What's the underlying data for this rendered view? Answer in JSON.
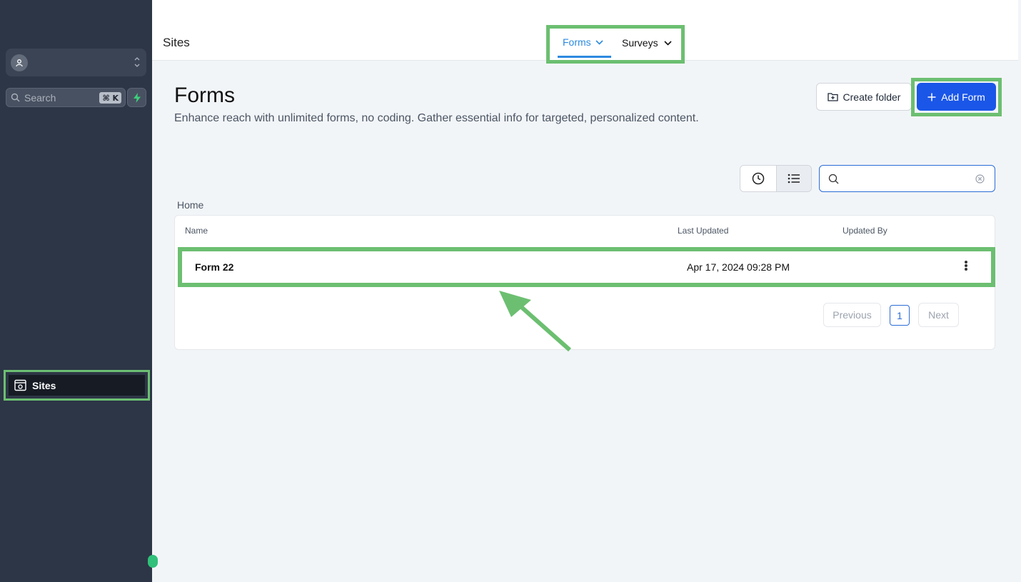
{
  "sidebar": {
    "search_label": "Search",
    "search_shortcut": "⌘ K",
    "nav_sites_label": "Sites"
  },
  "topbar": {
    "page_title": "Sites",
    "tabs": [
      {
        "label": "Forms",
        "active": true
      },
      {
        "label": "Surveys",
        "active": false
      }
    ]
  },
  "main": {
    "heading": "Forms",
    "subtitle": "Enhance reach with unlimited forms, no coding. Gather essential info for targeted, personalized content.",
    "create_folder_label": "Create folder",
    "add_form_label": "Add Form",
    "search_value": "",
    "breadcrumb": "Home"
  },
  "table": {
    "columns": [
      "Name",
      "Last Updated",
      "Updated By"
    ],
    "rows": [
      {
        "name": "Form 22",
        "last_updated": "Apr 17, 2024 09:28 PM",
        "updated_by": ""
      }
    ]
  },
  "pagination": {
    "previous_label": "Previous",
    "current_page": "1",
    "next_label": "Next"
  },
  "colors": {
    "highlight": "#6cbf71",
    "primary": "#1a56e8",
    "sidebar_bg": "#2d3646",
    "tab_active": "#2c8ae0"
  }
}
